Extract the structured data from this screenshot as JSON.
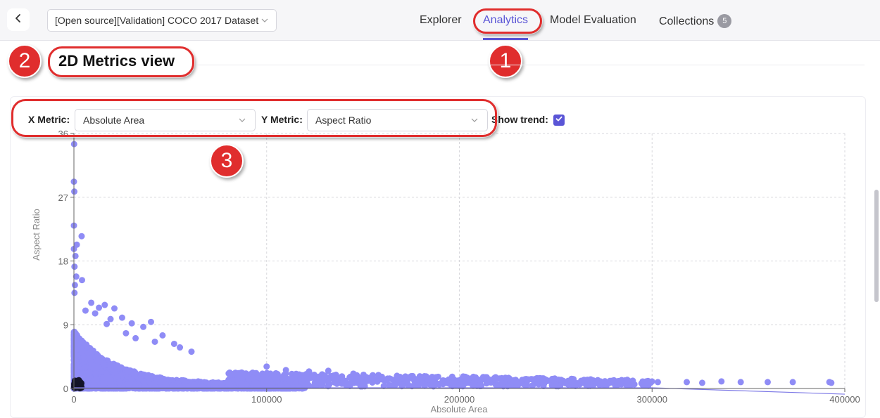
{
  "topbar": {
    "back_icon": "chevron-left-icon",
    "dataset": "[Open source][Validation] COCO 2017 Dataset",
    "tabs": [
      {
        "label": "Explorer"
      },
      {
        "label": "Analytics",
        "active": true
      },
      {
        "label": "Model Evaluation"
      },
      {
        "label": "Collections",
        "badge": "5"
      }
    ]
  },
  "section": {
    "title": "2D Metrics view"
  },
  "controls": {
    "x_metric_label": "X Metric:",
    "x_metric_value": "Absolute Area",
    "y_metric_label": "Y Metric:",
    "y_metric_value": "Aspect Ratio",
    "show_trend_label": "Show trend:",
    "show_trend_checked": true
  },
  "annotations": [
    "1",
    "2",
    "3"
  ],
  "colors": {
    "accent": "#5a55d6",
    "point": "#8f8cf6",
    "annotation": "#e02d2d"
  },
  "chart_data": {
    "type": "scatter",
    "xlabel": "Absolute Area",
    "ylabel": "Aspect Ratio",
    "xlim": [
      0,
      400000
    ],
    "ylim": [
      0,
      36
    ],
    "xticks": [
      "0",
      "100000",
      "200000",
      "300000",
      "400000"
    ],
    "yticks": [
      "0",
      "9",
      "18",
      "27",
      "36"
    ],
    "grid": true,
    "trend_line": [
      [
        0,
        0.1
      ],
      [
        300000,
        0.1
      ],
      [
        400000,
        -0.8
      ]
    ],
    "outliers": [
      [
        100,
        34.5
      ],
      [
        0,
        29.2
      ],
      [
        200,
        27.8
      ],
      [
        0,
        23.0
      ],
      [
        4000,
        21.5
      ],
      [
        1500,
        20.3
      ],
      [
        0,
        19.7
      ],
      [
        800,
        18.7
      ],
      [
        300,
        17.2
      ],
      [
        1200,
        15.8
      ],
      [
        4200,
        15.3
      ],
      [
        500,
        14.6
      ],
      [
        300,
        13.5
      ],
      [
        9000,
        12.1
      ],
      [
        16000,
        11.8
      ],
      [
        13000,
        11.4
      ],
      [
        21000,
        11.3
      ],
      [
        6000,
        11.0
      ],
      [
        11000,
        10.6
      ],
      [
        25000,
        10.0
      ],
      [
        19000,
        9.8
      ],
      [
        40000,
        9.4
      ],
      [
        30000,
        9.2
      ],
      [
        17000,
        9.1
      ],
      [
        36000,
        8.7
      ],
      [
        46000,
        7.5
      ],
      [
        52000,
        6.3
      ],
      [
        27000,
        7.8
      ],
      [
        32000,
        7.1
      ],
      [
        42000,
        6.6
      ],
      [
        55000,
        5.8
      ],
      [
        61000,
        5.2
      ]
    ],
    "tail": [
      [
        100000,
        3.1
      ],
      [
        110000,
        2.6
      ],
      [
        122000,
        2.4
      ],
      [
        132000,
        2.5
      ],
      [
        145000,
        2.1
      ],
      [
        158000,
        1.9
      ],
      [
        172000,
        1.7
      ],
      [
        188000,
        1.6
      ],
      [
        202000,
        1.7
      ],
      [
        214000,
        1.5
      ],
      [
        226000,
        1.4
      ],
      [
        238000,
        1.3
      ],
      [
        249000,
        1.2
      ],
      [
        258000,
        1.0
      ],
      [
        266000,
        1.2
      ],
      [
        274000,
        0.9
      ],
      [
        282000,
        1.0
      ],
      [
        290000,
        1.1
      ],
      [
        297000,
        1.0
      ],
      [
        303000,
        0.9
      ],
      [
        318000,
        0.9
      ],
      [
        326000,
        0.8
      ],
      [
        336000,
        1.0
      ],
      [
        346000,
        0.9
      ],
      [
        360000,
        0.9
      ],
      [
        373000,
        0.9
      ],
      [
        392000,
        0.9
      ],
      [
        393000,
        0.8
      ]
    ]
  }
}
